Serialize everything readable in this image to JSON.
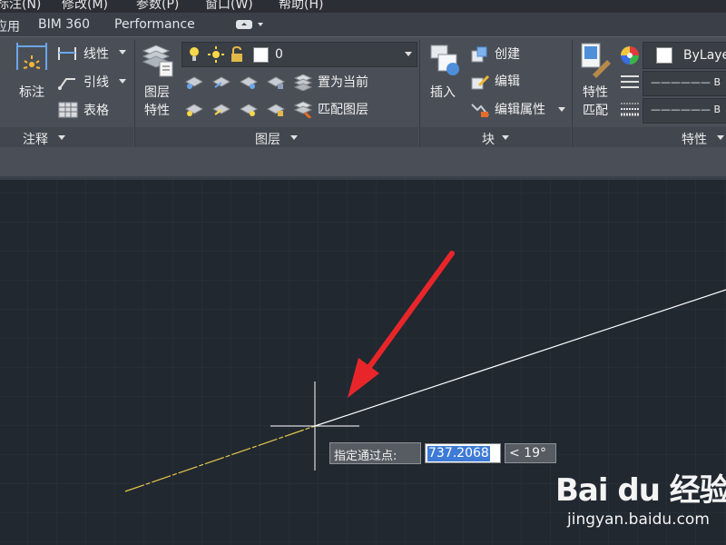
{
  "menu": {
    "items": [
      "标注(N)",
      "修改(M)",
      "参数(P)",
      "窗口(W)",
      "帮助(H)"
    ]
  },
  "tabs": {
    "items": [
      "应用",
      "BIM 360",
      "Performance"
    ]
  },
  "annotation_panel": {
    "title": "注释",
    "dimension_label": "标注",
    "linear_label": "线性",
    "leader_label": "引线",
    "table_label": "表格"
  },
  "layers_panel": {
    "title": "图层",
    "layer_props_label": "图层\n特性",
    "layer_props_line1": "图层",
    "layer_props_line2": "特性",
    "current_layer": "0",
    "set_current_label": "置为当前",
    "match_layer_label": "匹配图层"
  },
  "block_panel": {
    "title": "块",
    "insert_label": "插入",
    "create_label": "创建",
    "edit_label": "编辑",
    "edit_attr_label": "编辑属性"
  },
  "properties_panel": {
    "title": "特性",
    "match_line1": "特性",
    "match_line2": "匹配",
    "color_value": "ByLaye",
    "linetype_value": "—————— B",
    "lineweight_value": "—————— B"
  },
  "command": {
    "prompt": "指定通过点:",
    "distance": "737.2068",
    "angle": "< 19°"
  },
  "colors": {
    "canvas": "#212830",
    "ribbon": "#4a4f57",
    "selected_line": "#e8c84a",
    "arrow": "#e8262a"
  },
  "watermark": {
    "logo": "Bai du 经验",
    "url": "jingyan.baidu.com"
  }
}
